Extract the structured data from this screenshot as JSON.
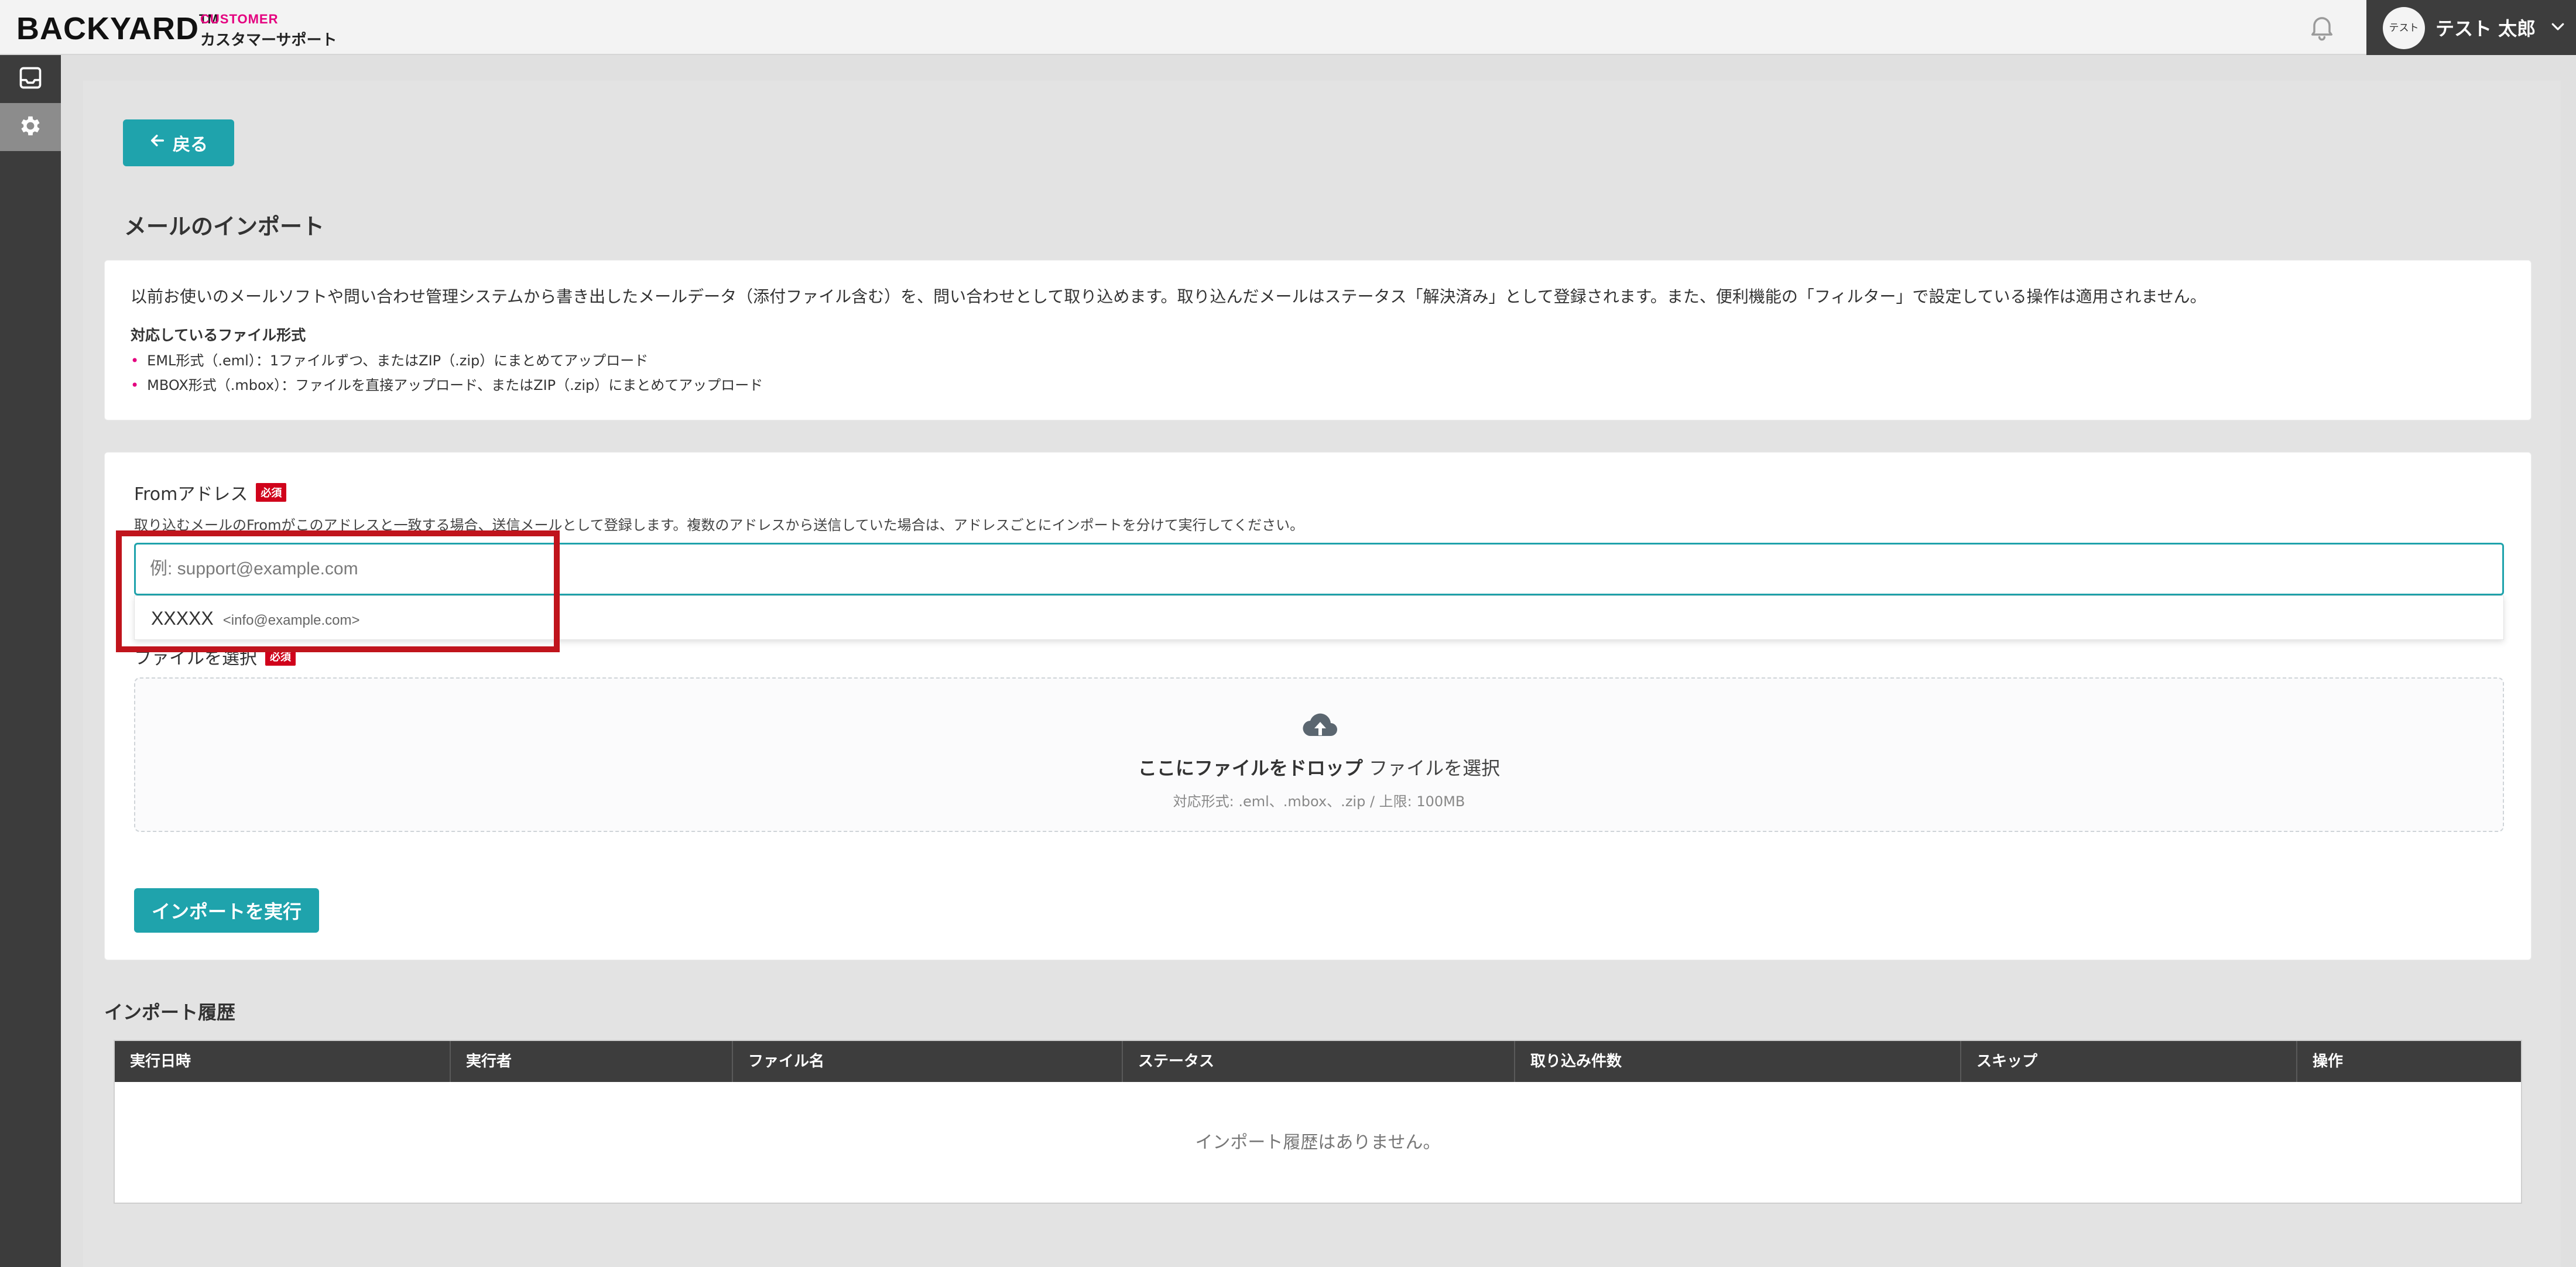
{
  "brand": {
    "logo": "BACKYARD",
    "trademark": "TM",
    "sub_top": "CUSTOMER",
    "sub_bottom": "カスタマーサポート",
    "accent_color": "#e4007f"
  },
  "header": {
    "user": {
      "avatar_text": "テスト",
      "name": "テスト 太郎"
    },
    "icons": [
      "bell-icon",
      "chevron-down-icon"
    ]
  },
  "sidebar": {
    "items": [
      {
        "icon": "inbox-icon",
        "active": false
      },
      {
        "icon": "gear-icon",
        "active": true
      }
    ]
  },
  "page": {
    "back_label": "戻る",
    "title": "メールのインポート"
  },
  "info": {
    "description": "以前お使いのメールソフトや問い合わせ管理システムから書き出したメールデータ（添付ファイル含む）を、問い合わせとして取り込めます。取り込んだメールはステータス「解決済み」として登録されます。また、便利機能の「フィルター」で設定している操作は適用されません。",
    "formats_heading": "対応しているファイル形式",
    "formats": [
      "EML形式（.eml）：1ファイルずつ、またはZIP（.zip）にまとめてアップロード",
      "MBOX形式（.mbox）：ファイルを直接アップロード、またはZIP（.zip）にまとめてアップロード"
    ]
  },
  "form": {
    "from_label": "Fromアドレス",
    "required_badge": "必須",
    "from_help": "取り込むメールのFromがこのアドレスと一致する場合、送信メールとして登録します。複数のアドレスから送信していた場合は、アドレスごとにインポートを分けて実行してください。",
    "from_value": "",
    "from_placeholder": "例: support@example.com",
    "suggestion": {
      "name": "XXXXX",
      "email": "<info@example.com>"
    },
    "file_label": "ファイルを選択",
    "drop_strong": "ここにファイルをドロップ",
    "drop_link": "ファイルを選択",
    "drop_sub": "対応形式: .eml、.mbox、.zip / 上限: 100MB",
    "import_button": "インポートを実行",
    "accent_color": "#1fa3ac"
  },
  "history": {
    "title": "インポート履歴",
    "columns": [
      "実行日時",
      "実行者",
      "ファイル名",
      "ステータス",
      "取り込み件数",
      "スキップ",
      "操作"
    ],
    "empty_text": "インポート履歴はありません。"
  }
}
